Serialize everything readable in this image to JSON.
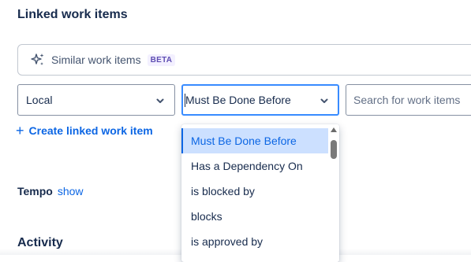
{
  "section": {
    "title": "Linked work items"
  },
  "similar": {
    "label": "Similar work items",
    "badge": "BETA",
    "icon": "sparkle-icon"
  },
  "scope_select": {
    "value": "Local",
    "icon": "chevron-down-icon"
  },
  "link_type_select": {
    "value": "Must Be Done Before",
    "icon": "chevron-down-icon"
  },
  "search": {
    "placeholder": "Search for work items"
  },
  "create_link": {
    "icon": "plus-icon",
    "label": "Create linked work item"
  },
  "tempo": {
    "title": "Tempo",
    "action": "show"
  },
  "activity": {
    "title": "Activity"
  },
  "dropdown": {
    "options": [
      {
        "label": "Must Be Done Before",
        "selected": true
      },
      {
        "label": "Has a Dependency On",
        "selected": false
      },
      {
        "label": "is blocked by",
        "selected": false
      },
      {
        "label": "blocks",
        "selected": false
      },
      {
        "label": "is approved by",
        "selected": false
      }
    ]
  },
  "colors": {
    "link": "#0c66e4",
    "selected_bg": "#cce0ff",
    "focus_border": "#388bff",
    "text": "#172b4d"
  }
}
